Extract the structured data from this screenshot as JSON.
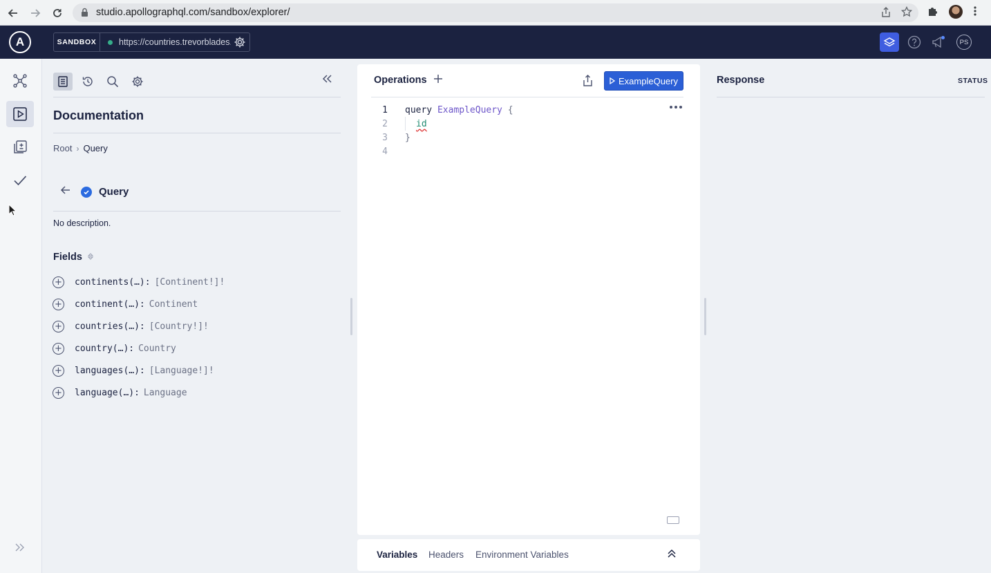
{
  "browser": {
    "url": "studio.apollographql.com/sandbox/explorer/"
  },
  "header": {
    "logo_letter": "A",
    "sandbox_label": "SANDBOX",
    "endpoint_url": "https://countries.trevorblades.com/",
    "profile_initials": "PS",
    "colors": {
      "header_bg": "#1b2240",
      "accent": "#3f5de0",
      "status_dot": "#36ad8a"
    }
  },
  "docs": {
    "title": "Documentation",
    "breadcrumb": {
      "root": "Root",
      "separator": "›",
      "current": "Query"
    },
    "type_name": "Query",
    "description": "No description.",
    "fields_heading": "Fields",
    "fields": [
      {
        "name": "continents(…):",
        "type": "[Continent!]!"
      },
      {
        "name": "continent(…):",
        "type": "Continent"
      },
      {
        "name": "countries(…):",
        "type": "[Country!]!"
      },
      {
        "name": "country(…):",
        "type": "Country"
      },
      {
        "name": "languages(…):",
        "type": "[Language!]!"
      },
      {
        "name": "language(…):",
        "type": "Language"
      }
    ]
  },
  "operations": {
    "title": "Operations",
    "run_button_label": "ExampleQuery",
    "code_lines": [
      {
        "num": "1",
        "keyword": "query",
        "name": "ExampleQuery",
        "punct": "{"
      },
      {
        "num": "2",
        "field": "id"
      },
      {
        "num": "3",
        "punct": "}"
      },
      {
        "num": "4"
      }
    ]
  },
  "variables_bar": {
    "tabs": [
      "Variables",
      "Headers",
      "Environment Variables"
    ]
  },
  "response": {
    "title": "Response",
    "status_label": "STATUS"
  }
}
